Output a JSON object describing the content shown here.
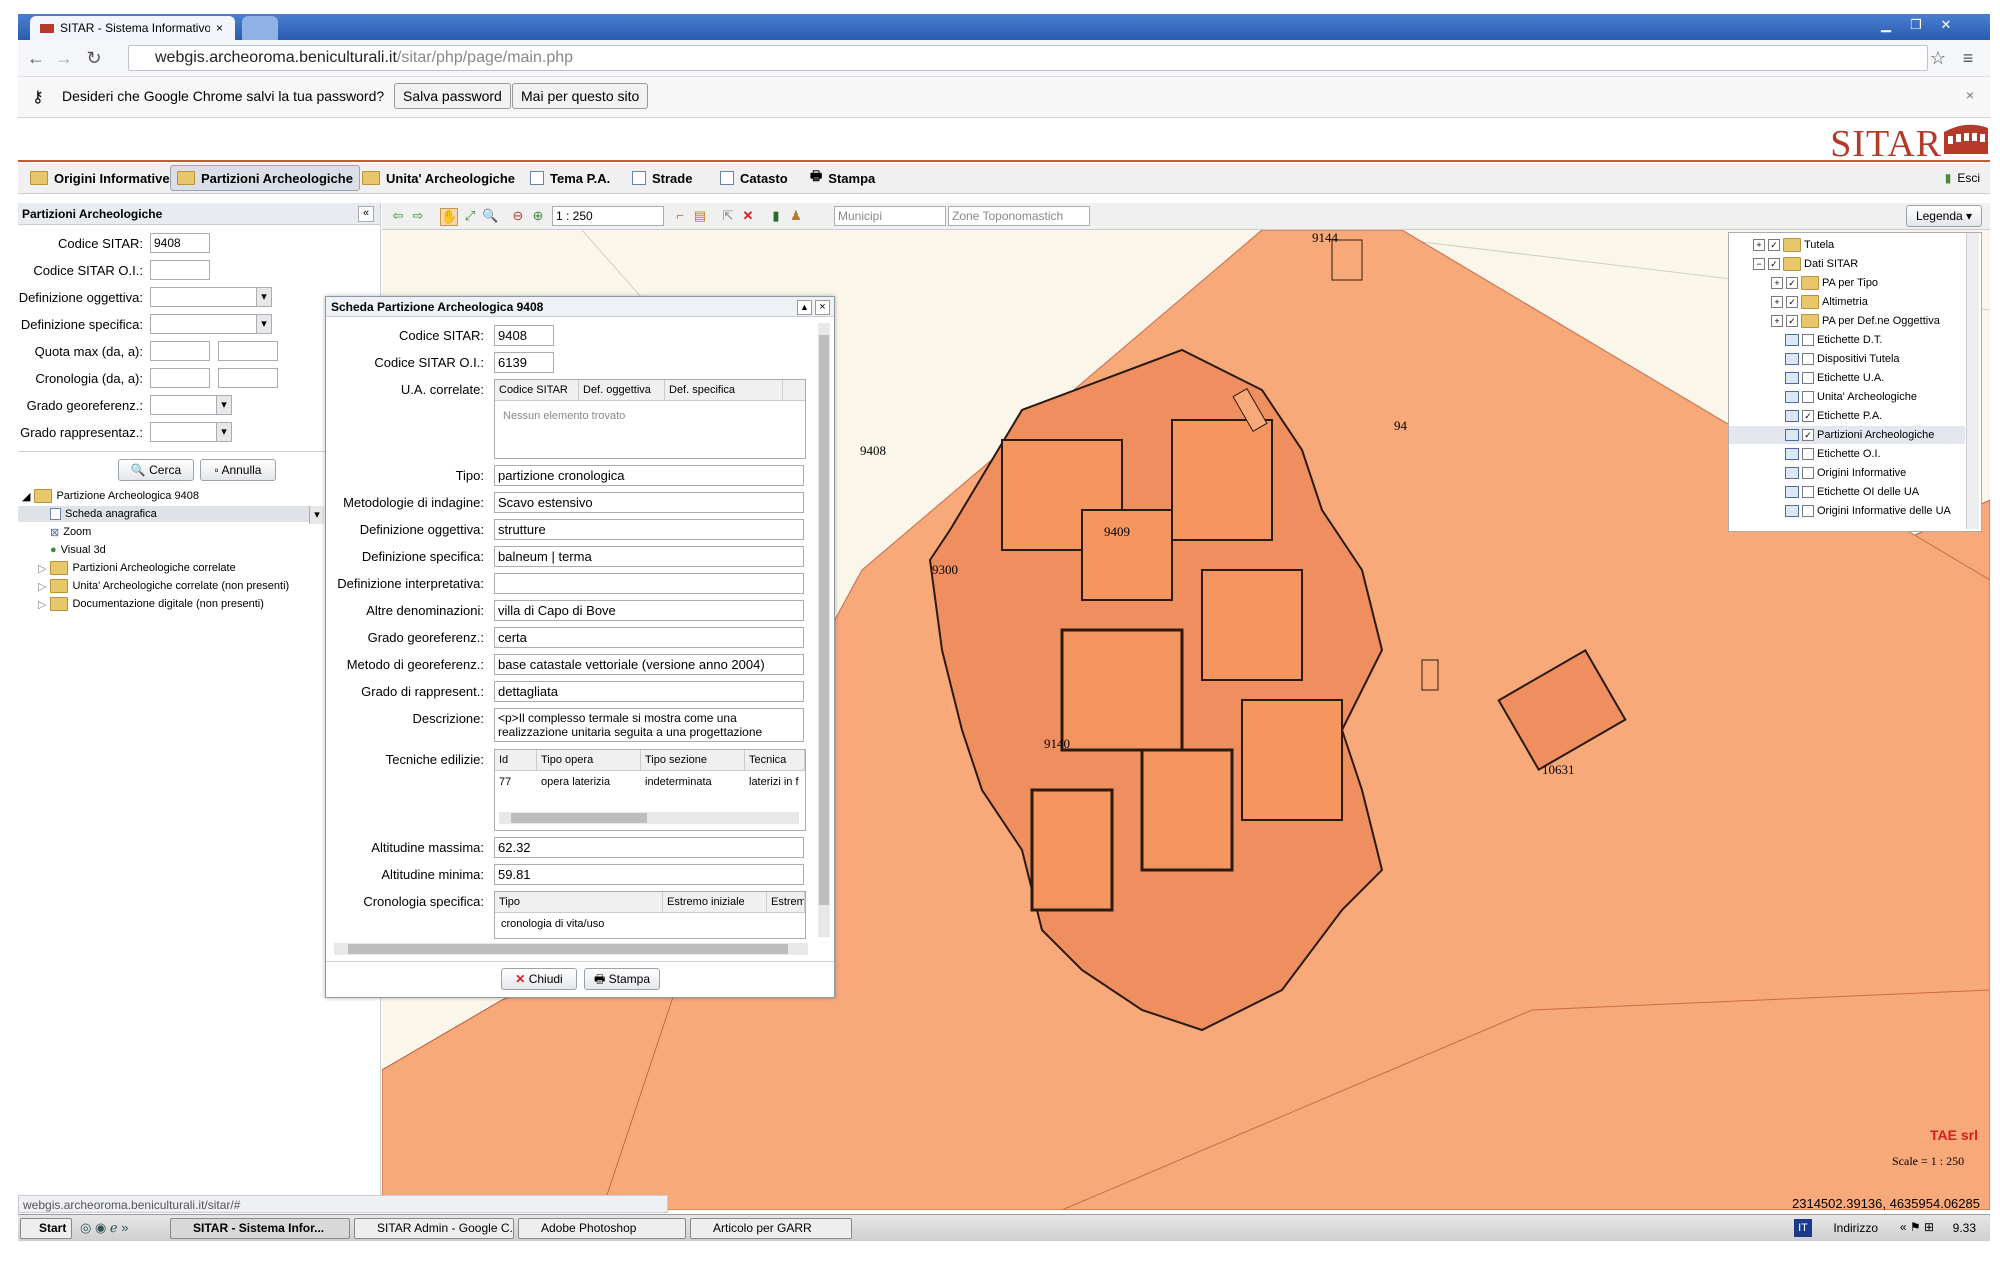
{
  "browser": {
    "tab_title": "SITAR - Sistema Informativo",
    "url_host": "webgis.archeoroma.beniculturali.it",
    "url_path": "/sitar/php/page/main.php",
    "infobar_text": "Desideri che Google Chrome salvi la tua password?",
    "save_password": "Salva password",
    "never_site": "Mai per questo sito"
  },
  "app": {
    "logo": "SITAR",
    "exit": "Esci",
    "tabs": [
      "Origini Informative",
      "Partizioni Archeologiche",
      "Unita' Archeologiche",
      "Tema P.A.",
      "Strade",
      "Catasto",
      "Stampa"
    ]
  },
  "left": {
    "title": "Partizioni Archeologiche",
    "fields": {
      "codice_sitar_label": "Codice SITAR:",
      "codice_sitar_value": "9408",
      "codice_oi_label": "Codice SITAR O.I.:",
      "def_oggettiva_label": "Definizione oggettiva:",
      "def_specifica_label": "Definizione specifica:",
      "quota_label": "Quota max (da, a):",
      "cronologia_label": "Cronologia (da, a):",
      "grado_geo_label": "Grado georeferenz.:",
      "grado_rapp_label": "Grado rappresentaz.:"
    },
    "search": "Cerca",
    "cancel": "Annulla",
    "tree": {
      "root": "Partizione Archeologica 9408",
      "items": [
        "Scheda anagrafica",
        "Zoom",
        "Visual 3d",
        "Partizioni Archeologiche correlate",
        "Unita' Archeologiche correlate (non presenti)",
        "Documentazione digitale (non presenti)"
      ]
    }
  },
  "map_toolbar": {
    "scale": "1 : 250",
    "municipi": "Municipi",
    "zone": "Zone Toponomastich",
    "legend_btn": "Legenda"
  },
  "map": {
    "labels": [
      "9408",
      "9409",
      "9300",
      "9140",
      "10631",
      "9144",
      "94"
    ],
    "credit": "TAE srl",
    "scale_text": "Scale = 1 : 250",
    "coords": "2314502.39136, 4635954.06285"
  },
  "legend": {
    "items": [
      "Tutela",
      "Dati SITAR",
      "PA per Tipo",
      "Altimetria",
      "PA per Def.ne Oggettiva",
      "Etichette D.T.",
      "Dispositivi Tutela",
      "Etichette U.A.",
      "Unita' Archeologiche",
      "Etichette P.A.",
      "Partizioni Archeologiche",
      "Etichette O.I.",
      "Origini Informative",
      "Etichette OI delle UA",
      "Origini Informative delle UA"
    ]
  },
  "dialog": {
    "title": "Scheda Partizione Archeologica 9408",
    "codice_sitar_label": "Codice SITAR:",
    "codice_sitar": "9408",
    "codice_oi_label": "Codice SITAR O.I.:",
    "codice_oi": "6139",
    "ua_label": "U.A. correlate:",
    "ua_cols": [
      "Codice SITAR",
      "Def. oggettiva",
      "Def. specifica"
    ],
    "ua_empty": "Nessun elemento trovato",
    "tipo_label": "Tipo:",
    "tipo": "partizione cronologica",
    "metodologie_label": "Metodologie di indagine:",
    "metodologie": "Scavo estensivo",
    "def_ogg_label": "Definizione oggettiva:",
    "def_ogg": "strutture",
    "def_spec_label": "Definizione specifica:",
    "def_spec": "balneum | terma",
    "def_interp_label": "Definizione interpretativa:",
    "altre_label": "Altre denominazioni:",
    "altre": "villa di Capo di Bove",
    "grado_geo_label": "Grado georeferenz.:",
    "grado_geo": "certa",
    "metodo_geo_label": "Metodo di georeferenz.:",
    "metodo_geo": "base catastale vettoriale (versione anno 2004)",
    "grado_rapp_label": "Grado di rappresent.:",
    "grado_rapp": "dettagliata",
    "descr_label": "Descrizione:",
    "descr": "<p>Il complesso termale si mostra come una realizzazione unitaria seguita a una progettazione",
    "tecniche_label": "Tecniche edilizie:",
    "tec_cols": [
      "Id",
      "Tipo opera",
      "Tipo sezione",
      "Tecnica"
    ],
    "tec_row": [
      "77",
      "opera laterizia",
      "indeterminata",
      "laterizi in f"
    ],
    "alt_max_label": "Altitudine massima:",
    "alt_max": "62.32",
    "alt_min_label": "Altitudine minima:",
    "alt_min": "59.81",
    "crono_label": "Cronologia specifica:",
    "crono_cols": [
      "Tipo",
      "Estremo iniziale",
      "Estrem"
    ],
    "crono_row": "cronologia di vita/uso",
    "close": "Chiudi",
    "print": "Stampa"
  },
  "statusbar": "webgis.archeoroma.beniculturali.it/sitar/#",
  "taskbar": {
    "start": "Start",
    "tasks": [
      "SITAR - Sistema Infor...",
      "SITAR Admin - Google C...",
      "Adobe Photoshop",
      "Articolo per GARR"
    ],
    "lang": "IT",
    "address": "Indirizzo",
    "time": "9.33"
  }
}
